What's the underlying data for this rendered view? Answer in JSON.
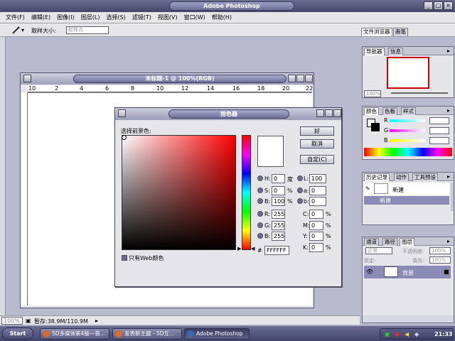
{
  "window": {
    "title": "Adobe Photoshop"
  },
  "menu": [
    "文件(F)",
    "编辑(E)",
    "图像(I)",
    "图层(L)",
    "选择(S)",
    "滤镜(T)",
    "视图(V)",
    "窗口(W)",
    "帮助(H)"
  ],
  "options": {
    "sample_size_label": "取样大小:",
    "sample_size_value": "取样点"
  },
  "palette_well": {
    "tabs": [
      "文件浏览器",
      "画笔"
    ]
  },
  "document": {
    "title": "未标题-1 @ 100%(RGB)",
    "ruler_ticks": [
      "10",
      "2",
      "4",
      "6",
      "8",
      "10",
      "12",
      "14",
      "16",
      "18",
      "20",
      "22"
    ]
  },
  "status": {
    "zoom": "100%",
    "doc_size": "暂存:38.9M/110.9M"
  },
  "color_picker": {
    "title": "拾色器",
    "prompt": "选择前景色:",
    "ok": "好",
    "cancel": "取消",
    "custom": "自定(C)",
    "web_only": "只有Web颜色",
    "hsb": {
      "H": "0",
      "S": "0",
      "B": "100",
      "deg": "度",
      "pct": "%"
    },
    "rgb": {
      "R": "255",
      "G": "255",
      "B": "255"
    },
    "lab": {
      "L": "100",
      "a": "0",
      "b": "0"
    },
    "cmyk": {
      "C": "0",
      "M": "0",
      "Y": "0",
      "K": "0"
    },
    "hex_label": "#",
    "hex": "FFFFFF",
    "hue_color": "#ff0000"
  },
  "navigator": {
    "tabs": [
      "导航器",
      "信息"
    ],
    "zoom": "100%"
  },
  "color_panel": {
    "tabs": [
      "颜色",
      "色板",
      "样式"
    ],
    "channels": [
      "R",
      "G",
      "B"
    ]
  },
  "history": {
    "tabs": [
      "历史记录",
      "动作",
      "工具预设"
    ],
    "items": [
      "新建",
      "新建"
    ]
  },
  "layers": {
    "tabs": [
      "通道",
      "路径",
      "图层"
    ],
    "blend": "正常",
    "opacity_label": "不透明度:",
    "opacity": "100%",
    "lock_label": "锁定:",
    "fill_label": "填充:",
    "fill": "100%",
    "layer_name": "背景"
  },
  "taskbar": {
    "start": "Start",
    "items": [
      "5D多媒体第4版—首...",
      "发表新主题 - 5D互...",
      "Adobe Photoshop"
    ],
    "time": "21:33"
  }
}
